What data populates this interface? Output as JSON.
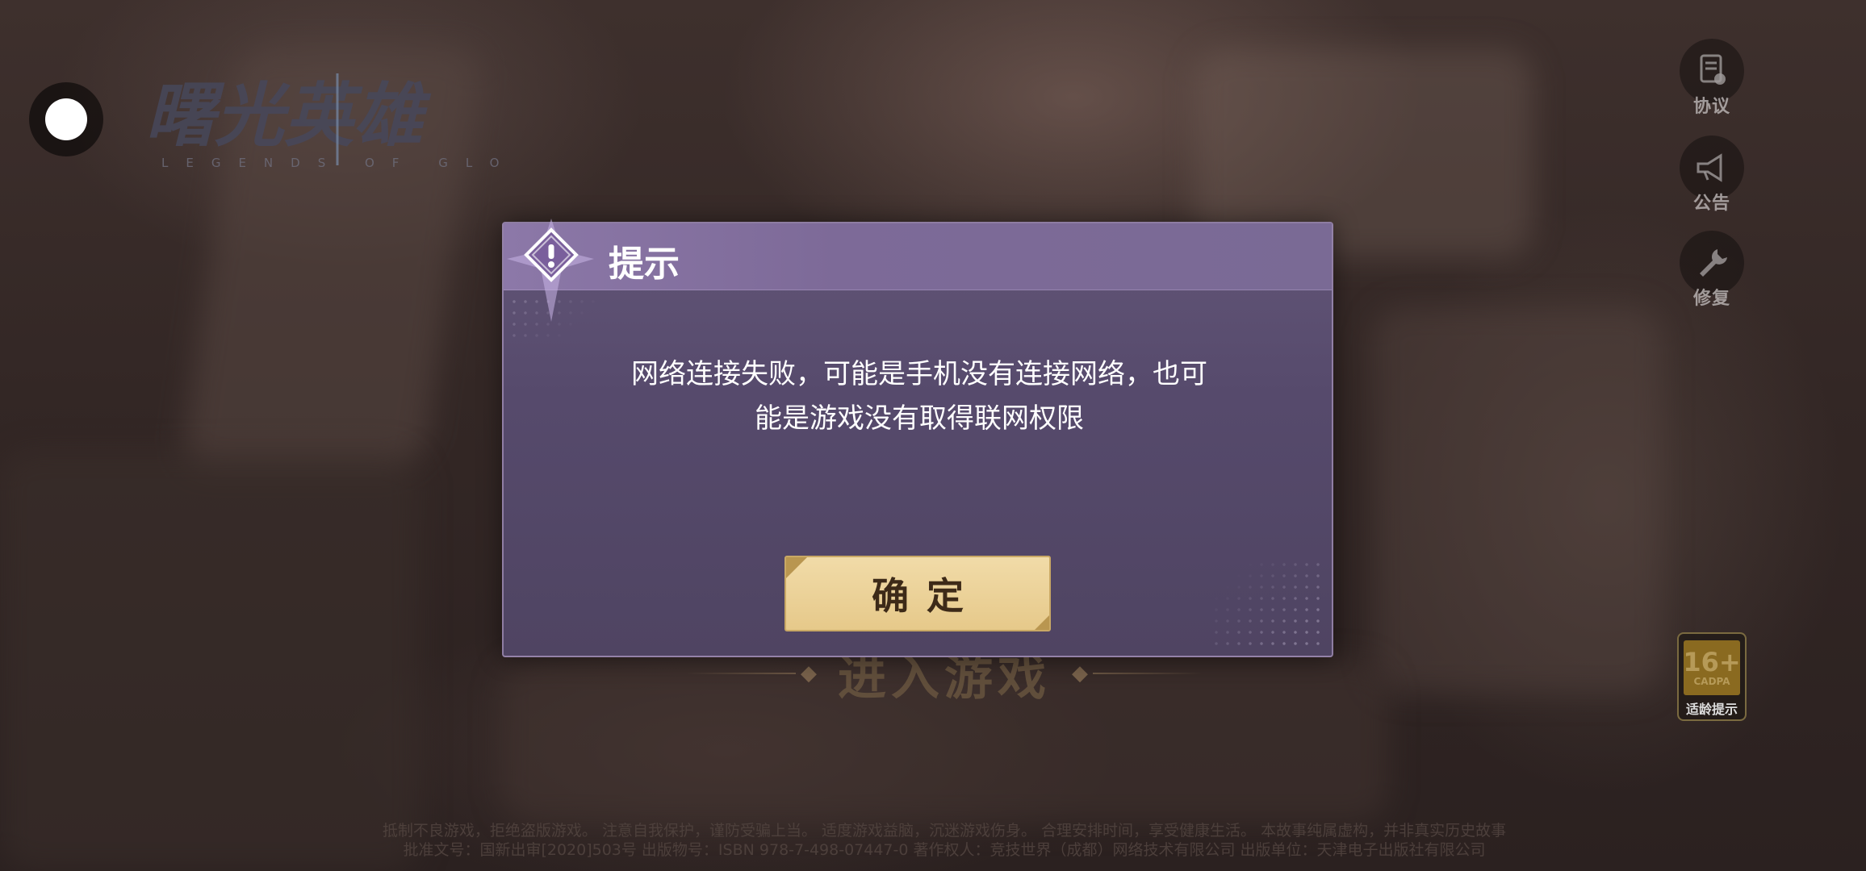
{
  "background": {
    "logo_text": "曙光英雄",
    "logo_subtitle": "LEGENDS OF GLO",
    "enter_game_label": "进入游戏"
  },
  "side_buttons": [
    {
      "label": "协议",
      "icon": "document-check-icon"
    },
    {
      "label": "公告",
      "icon": "megaphone-icon"
    },
    {
      "label": "修复",
      "icon": "wrench-icon"
    }
  ],
  "age_rating": {
    "number": "16+",
    "org": "CADPA",
    "label": "适龄提示"
  },
  "legal": {
    "line1": "抵制不良游戏，拒绝盗版游戏。 注意自我保护，谨防受骗上当。 适度游戏益脑，沉迷游戏伤身。 合理安排时间，享受健康生活。 本故事纯属虚构，并非真实历史故事",
    "line2": "批准文号：国新出审[2020]503号 出版物号：ISBN 978-7-498-07447-0 著作权人：竞技世界（成都）网络技术有限公司 出版单位：天津电子出版社有限公司"
  },
  "dialog": {
    "title": "提示",
    "message_line1": "网络连接失败，可能是手机没有连接网络，也可",
    "message_line2": "能是游戏没有取得联网权限",
    "confirm_label": "确定"
  },
  "colors": {
    "dialog_bg": "#564a6c",
    "dialog_header": "#8c78a8",
    "confirm_bg": "#ecd29a",
    "confirm_text": "#3d2a18"
  }
}
